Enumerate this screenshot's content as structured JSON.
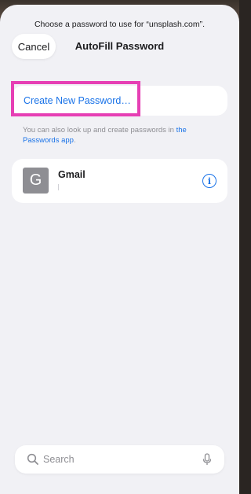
{
  "header": {
    "prompt": "Choose a password to use for “unsplash.com”.",
    "title": "AutoFill Password",
    "cancel_label": "Cancel"
  },
  "create": {
    "label": "Create New Password…",
    "highlight_color": "#e63fb4"
  },
  "helper": {
    "text": "You can also look up and create passwords in ",
    "link": "the Passwords app",
    "suffix": "."
  },
  "accounts": [
    {
      "initial": "G",
      "name": "Gmail",
      "info_icon": "info-circle-icon"
    }
  ],
  "search": {
    "placeholder": "Search",
    "icon": "search-icon",
    "mic_icon": "microphone-icon"
  },
  "colors": {
    "accent": "#1a73e8",
    "sheet_bg": "#f1f1f5",
    "secondary_text": "#8e8e93"
  }
}
